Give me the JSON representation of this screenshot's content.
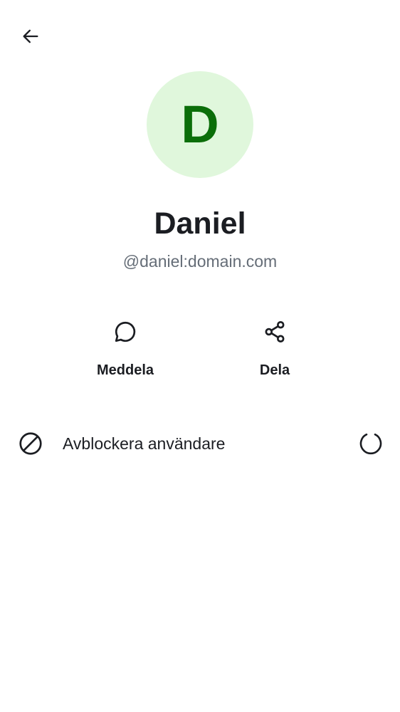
{
  "header": {
    "back_icon": "arrow-left-icon"
  },
  "profile": {
    "avatar_initial": "D",
    "avatar_bg_color": "#e0f7dc",
    "avatar_text_color": "#0b6e09",
    "display_name": "Daniel",
    "user_id": "@daniel:domain.com"
  },
  "actions": [
    {
      "label": "Meddela",
      "icon": "chat-bubble-icon"
    },
    {
      "label": "Dela",
      "icon": "share-icon"
    }
  ],
  "unblock": {
    "label": "Avblockera användare",
    "icon": "block-icon",
    "status_icon": "loading-spinner-icon"
  }
}
